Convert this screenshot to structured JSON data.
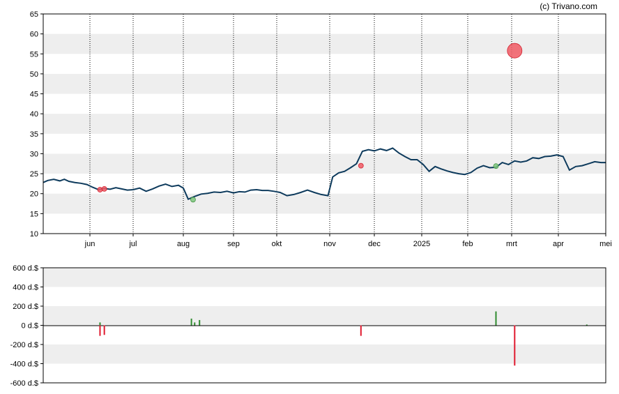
{
  "credit": "(c) Trivano.com",
  "colors": {
    "band": "#eeeeee",
    "price_line": "#0d3a5c",
    "buy": "#2e8b2e",
    "sell": "#e0192e",
    "sell_marker": "#f05a64",
    "buy_marker": "#7bc47b"
  },
  "chart_data": [
    {
      "type": "line",
      "x_tick_labels": [
        "jun",
        "jul",
        "aug",
        "sep",
        "okt",
        "nov",
        "dec",
        "2025",
        "feb",
        "mrt",
        "apr",
        "mei"
      ],
      "y_tick_labels": [
        "65",
        "60",
        "55",
        "50",
        "45",
        "40",
        "35",
        "30",
        "25",
        "20",
        "15",
        "10"
      ],
      "ylim": [
        10,
        65
      ],
      "grid": true,
      "series": [
        {
          "x": [
            "2024-05-01",
            "2024-05-04",
            "2024-05-08",
            "2024-05-12",
            "2024-05-15",
            "2024-05-18",
            "2024-05-22",
            "2024-05-26",
            "2024-05-30",
            "2024-06-03",
            "2024-06-07",
            "2024-06-11",
            "2024-06-15",
            "2024-06-19",
            "2024-06-23",
            "2024-06-27",
            "2024-07-01",
            "2024-07-05",
            "2024-07-09",
            "2024-07-13",
            "2024-07-17",
            "2024-07-21",
            "2024-07-25",
            "2024-07-29",
            "2024-08-01",
            "2024-08-04",
            "2024-08-08",
            "2024-08-12",
            "2024-08-16",
            "2024-08-20",
            "2024-08-24",
            "2024-08-28",
            "2024-09-01",
            "2024-09-05",
            "2024-09-09",
            "2024-09-13",
            "2024-09-17",
            "2024-09-21",
            "2024-09-25",
            "2024-09-29",
            "2024-10-03",
            "2024-10-07",
            "2024-10-11",
            "2024-10-15",
            "2024-10-19",
            "2024-10-23",
            "2024-10-27",
            "2024-10-31",
            "2024-11-03",
            "2024-11-07",
            "2024-11-11",
            "2024-11-15",
            "2024-11-19",
            "2024-11-23",
            "2024-11-27",
            "2024-12-01",
            "2024-12-05",
            "2024-12-09",
            "2024-12-13",
            "2024-12-17",
            "2024-12-21",
            "2024-12-25",
            "2024-12-29",
            "2025-01-02",
            "2025-01-06",
            "2025-01-10",
            "2025-01-14",
            "2025-01-18",
            "2025-01-22",
            "2025-01-26",
            "2025-01-30",
            "2025-02-03",
            "2025-02-07",
            "2025-02-11",
            "2025-02-15",
            "2025-02-19",
            "2025-02-23",
            "2025-02-27",
            "2025-03-03",
            "2025-03-07",
            "2025-03-11",
            "2025-03-15",
            "2025-03-19",
            "2025-03-23",
            "2025-03-27",
            "2025-03-31",
            "2025-04-04",
            "2025-04-08",
            "2025-04-12",
            "2025-04-16",
            "2025-04-20",
            "2025-04-24",
            "2025-04-28",
            "2025-05-01"
          ],
          "y": [
            22.8,
            23.3,
            23.6,
            23.2,
            23.6,
            23.1,
            22.8,
            22.6,
            22.3,
            21.6,
            21.0,
            21.3,
            21.1,
            21.5,
            21.2,
            20.9,
            21.0,
            21.4,
            20.6,
            21.2,
            21.9,
            22.4,
            21.8,
            22.1,
            21.4,
            18.6,
            19.3,
            19.9,
            20.1,
            20.4,
            20.3,
            20.6,
            20.2,
            20.5,
            20.4,
            20.9,
            21.0,
            20.8,
            20.8,
            20.6,
            20.3,
            19.5,
            19.8,
            20.3,
            20.9,
            20.3,
            19.8,
            19.5,
            24.2,
            25.2,
            25.6,
            26.5,
            27.5,
            30.6,
            31.0,
            30.7,
            31.2,
            30.8,
            31.4,
            30.2,
            29.3,
            28.5,
            28.5,
            27.3,
            25.6,
            26.8,
            26.2,
            25.7,
            25.3,
            25.0,
            24.8,
            25.3,
            26.4,
            27.0,
            26.5,
            26.6,
            27.8,
            27.3,
            28.2,
            27.9,
            28.2,
            29.0,
            28.8,
            29.3,
            29.4,
            29.7,
            29.3,
            25.9,
            26.8,
            27.0,
            27.5,
            28.0,
            27.8,
            27.8
          ]
        }
      ],
      "markers": [
        {
          "x": "2024-06-08",
          "y": 21.0,
          "kind": "sell",
          "size": 1
        },
        {
          "x": "2024-06-11",
          "y": 21.2,
          "kind": "sell",
          "size": 1
        },
        {
          "x": "2024-08-07",
          "y": 18.5,
          "kind": "buy",
          "size": 1
        },
        {
          "x": "2024-11-22",
          "y": 27.0,
          "kind": "sell",
          "size": 1
        },
        {
          "x": "2025-02-19",
          "y": 26.9,
          "kind": "buy",
          "size": 1
        },
        {
          "x": "2025-03-03",
          "y": 55.8,
          "kind": "sell",
          "size": 3
        }
      ]
    },
    {
      "type": "bar",
      "y_tick_labels": [
        "600 d.$",
        "400 d.$",
        "200 d.$",
        "0 d.$",
        "-200 d.$",
        "-400 d.$",
        "-600 d.$"
      ],
      "ylim": [
        -600,
        600
      ],
      "grid": true,
      "bars": [
        {
          "x": "2024-06-08",
          "value": 30
        },
        {
          "x": "2024-06-08",
          "value": -110
        },
        {
          "x": "2024-06-11",
          "value": -100
        },
        {
          "x": "2024-08-06",
          "value": 70
        },
        {
          "x": "2024-08-08",
          "value": 30
        },
        {
          "x": "2024-08-11",
          "value": 55
        },
        {
          "x": "2024-11-22",
          "value": -110
        },
        {
          "x": "2025-02-19",
          "value": 145
        },
        {
          "x": "2025-03-03",
          "value": -420
        },
        {
          "x": "2025-04-19",
          "value": 8
        }
      ]
    }
  ]
}
